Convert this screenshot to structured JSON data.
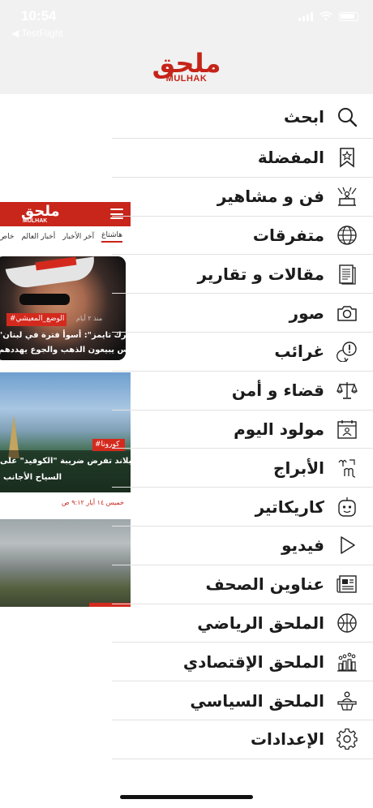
{
  "status_bar": {
    "time": "10:54",
    "back_label": "◀ TestFlight"
  },
  "header": {
    "logo_arabic": "ملحق",
    "logo_latin": "MULHAK",
    "brand_color": "#c52418"
  },
  "preview": {
    "logo_arabic": "ملحق",
    "logo_latin": "MULHAK",
    "tabs": [
      "هاشتاغ",
      "آخر الأخبار",
      "أخبار العالم",
      "خاص"
    ],
    "article1": {
      "hashtag": "#الوضع_المعيشي",
      "time": "منذ ٢ أيام",
      "headline_line1": "\"نيويورك تايمز\": أسوأ فترة في لبنان..",
      "headline_line2": "الناس يبيعون الذهب والجوع يهددهم"
    },
    "article2": {
      "hashtag": "#كورونا",
      "headline_line1": "تايلاند تفرض ضريبة \"الكوفيد\" على",
      "headline_line2": "السياح الأجانب"
    },
    "timestamp": "خميس ١٤ أيار ٩:١٢ ص"
  },
  "menu": {
    "items": [
      {
        "label": "ابحث",
        "icon": "search-icon"
      },
      {
        "label": "المفضلة",
        "icon": "bookmark-star-icon"
      },
      {
        "label": "فن و مشاهير",
        "icon": "stage-icon"
      },
      {
        "label": "متفرقات",
        "icon": "globe-icon"
      },
      {
        "label": "مقالات و تقارير",
        "icon": "document-icon"
      },
      {
        "label": "صور",
        "icon": "camera-icon"
      },
      {
        "label": "غرائب",
        "icon": "exclamation-bubble-icon"
      },
      {
        "label": "قضاء و أمن",
        "icon": "scales-icon"
      },
      {
        "label": "مولود اليوم",
        "icon": "calendar-person-icon"
      },
      {
        "label": "الأبراج",
        "icon": "zodiac-icon"
      },
      {
        "label": "كاريكاتير",
        "icon": "smiley-robot-icon"
      },
      {
        "label": "فيديو",
        "icon": "play-icon"
      },
      {
        "label": "عناوين الصحف",
        "icon": "newspaper-icon"
      },
      {
        "label": "الملحق الرياضي",
        "icon": "basketball-icon"
      },
      {
        "label": "الملحق الإقتصادي",
        "icon": "bar-chart-people-icon"
      },
      {
        "label": "الملحق السياسي",
        "icon": "podium-icon"
      },
      {
        "label": "الإعدادات",
        "icon": "gear-icon"
      }
    ]
  }
}
